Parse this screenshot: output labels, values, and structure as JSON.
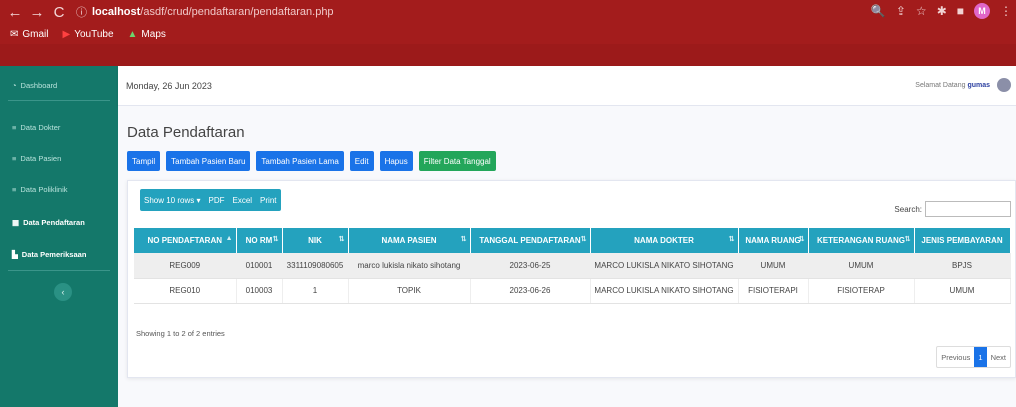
{
  "browser": {
    "url_host": "localhost",
    "url_path": "/asdf/crud/pendaftaran/pendaftaran.php",
    "profile_initial": "M",
    "bookmarks": [
      {
        "label": "Gmail"
      },
      {
        "label": "YouTube"
      },
      {
        "label": "Maps"
      }
    ]
  },
  "sidebar": {
    "items": [
      {
        "label": "Dashboard"
      },
      {
        "label": "Data Dokter"
      },
      {
        "label": "Data Pasien"
      },
      {
        "label": "Data Poliklinik"
      },
      {
        "label": "Data Pendaftaran"
      },
      {
        "label": "Data Pemeriksaan"
      }
    ]
  },
  "topbar": {
    "date": "Monday, 26 Jun 2023",
    "greeting": "Selamat Datang",
    "username": "gumas"
  },
  "main": {
    "title": "Data Pendaftaran",
    "buttons": {
      "tampil": "Tampil",
      "tambah_baru": "Tambah Pasien Baru",
      "tambah_lama": "Tambah Pasien Lama",
      "edit": "Edit",
      "hapus": "Hapus",
      "filter": "Filter Data Tanggal"
    }
  },
  "table_tools": {
    "show_rows": "Show 10 rows ▾",
    "pdf": "PDF",
    "excel": "Excel",
    "print": "Print",
    "search_label": "Search:"
  },
  "table": {
    "headers": [
      "NO PENDAFTARAN",
      "NO RM",
      "NIK",
      "NAMA PASIEN",
      "TANGGAL PENDAFTARAN",
      "NAMA DOKTER",
      "NAMA RUANG",
      "KETERANGAN RUANG",
      "JENIS PEMBAYARAN"
    ],
    "rows": [
      [
        "REG009",
        "010001",
        "3311109080605",
        "marco lukisla nikato sihotang",
        "2023-06-25",
        "MARCO LUKISLA NIKATO SIHOTANG",
        "UMUM",
        "UMUM",
        "BPJS"
      ],
      [
        "REG010",
        "010003",
        "1",
        "TOPIK",
        "2023-06-26",
        "MARCO LUKISLA NIKATO SIHOTANG",
        "FISIOTERAPI",
        "FISIOTERAP",
        "UMUM"
      ]
    ]
  },
  "footer": {
    "info": "Showing 1 to 2 of 2 entries",
    "previous": "Previous",
    "page": "1",
    "next": "Next"
  },
  "colors": {
    "browser": "#a31c1c",
    "sidebar": "#14786a",
    "primary": "#1a73e8",
    "table_header": "#24a2be",
    "success": "#23a65a"
  }
}
